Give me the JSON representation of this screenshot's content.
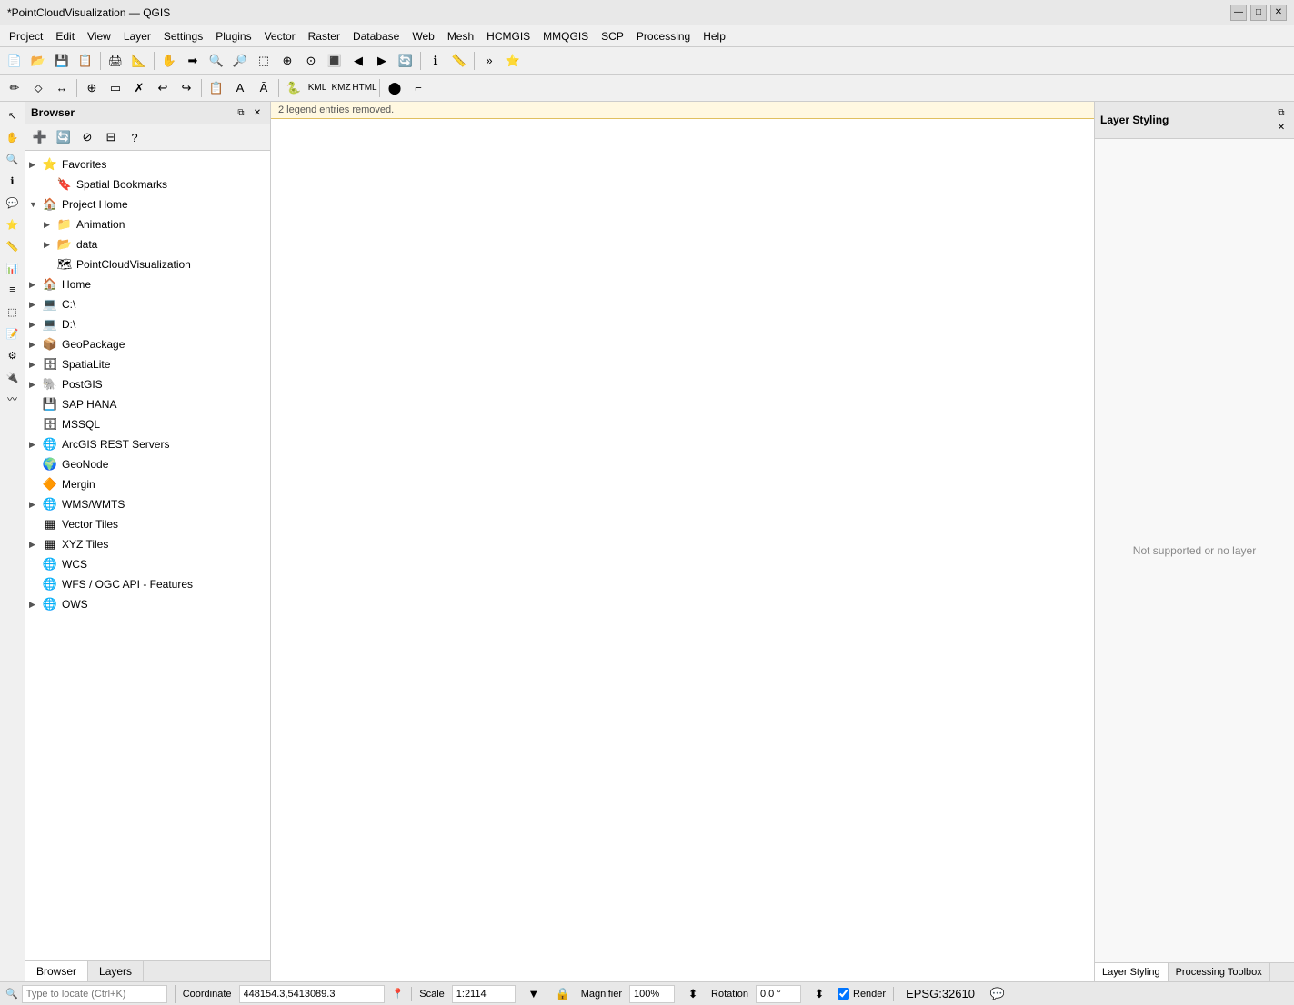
{
  "titleBar": {
    "title": "*PointCloudVisualization — QGIS",
    "minimizeLabel": "—",
    "maximizeLabel": "□",
    "closeLabel": "✕"
  },
  "menuBar": {
    "items": [
      "Project",
      "Edit",
      "View",
      "Layer",
      "Settings",
      "Plugins",
      "Vector",
      "Raster",
      "Database",
      "Web",
      "Mesh",
      "HCMGIS",
      "MMQGIS",
      "SCP",
      "Processing",
      "Help"
    ]
  },
  "browser": {
    "title": "Browser",
    "tree": [
      {
        "id": "favorites",
        "label": "Favorites",
        "indent": 0,
        "arrow": "▶",
        "icon": "⭐"
      },
      {
        "id": "spatial-bookmarks",
        "label": "Spatial Bookmarks",
        "indent": 1,
        "arrow": "",
        "icon": "🔖"
      },
      {
        "id": "project-home",
        "label": "Project Home",
        "indent": 0,
        "arrow": "▼",
        "icon": "🏠"
      },
      {
        "id": "animation",
        "label": "Animation",
        "indent": 1,
        "arrow": "▶",
        "icon": "📁"
      },
      {
        "id": "data",
        "label": "data",
        "indent": 1,
        "arrow": "▶",
        "icon": "📂"
      },
      {
        "id": "pointcloud",
        "label": "PointCloudVisualization",
        "indent": 1,
        "arrow": "",
        "icon": "🗺"
      },
      {
        "id": "home",
        "label": "Home",
        "indent": 0,
        "arrow": "▶",
        "icon": "🏠"
      },
      {
        "id": "c-drive",
        "label": "C:\\",
        "indent": 0,
        "arrow": "▶",
        "icon": "📁"
      },
      {
        "id": "d-drive",
        "label": "D:\\",
        "indent": 0,
        "arrow": "▶",
        "icon": "📁"
      },
      {
        "id": "geopackage",
        "label": "GeoPackage",
        "indent": 0,
        "arrow": "▶",
        "icon": "📦"
      },
      {
        "id": "spatialite",
        "label": "SpatiaLite",
        "indent": 0,
        "arrow": "▶",
        "icon": "🗄"
      },
      {
        "id": "postgis",
        "label": "PostGIS",
        "indent": 0,
        "arrow": "▶",
        "icon": "🐘"
      },
      {
        "id": "sap-hana",
        "label": "SAP HANA",
        "indent": 0,
        "arrow": "",
        "icon": "💾"
      },
      {
        "id": "mssql",
        "label": "MSSQL",
        "indent": 0,
        "arrow": "",
        "icon": "🗄"
      },
      {
        "id": "arcgis-rest",
        "label": "ArcGIS REST Servers",
        "indent": 0,
        "arrow": "▶",
        "icon": "🌐"
      },
      {
        "id": "geonode",
        "label": "GeoNode",
        "indent": 0,
        "arrow": "",
        "icon": "🌍"
      },
      {
        "id": "mergin",
        "label": "Mergin",
        "indent": 0,
        "arrow": "",
        "icon": "🔶"
      },
      {
        "id": "wms-wmts",
        "label": "WMS/WMTS",
        "indent": 0,
        "arrow": "▶",
        "icon": "🌐"
      },
      {
        "id": "vector-tiles",
        "label": "Vector Tiles",
        "indent": 0,
        "arrow": "",
        "icon": "▦"
      },
      {
        "id": "xyz-tiles",
        "label": "XYZ Tiles",
        "indent": 0,
        "arrow": "▶",
        "icon": "▦"
      },
      {
        "id": "wcs",
        "label": "WCS",
        "indent": 0,
        "arrow": "",
        "icon": "🌐"
      },
      {
        "id": "wfs-ogc",
        "label": "WFS / OGC API - Features",
        "indent": 0,
        "arrow": "",
        "icon": "🌐"
      },
      {
        "id": "ows",
        "label": "OWS",
        "indent": 0,
        "arrow": "▶",
        "icon": "🌐"
      }
    ]
  },
  "layerStyling": {
    "title": "Layer Styling",
    "noLayerText": "Not supported or no layer"
  },
  "bottomTabs": {
    "items": [
      {
        "id": "browser-tab",
        "label": "Browser"
      },
      {
        "id": "layers-tab",
        "label": "Layers"
      }
    ],
    "active": "browser-tab"
  },
  "rightBottomTabs": {
    "items": [
      {
        "id": "layer-styling-tab",
        "label": "Layer Styling"
      },
      {
        "id": "processing-toolbox-tab",
        "label": "Processing Toolbox"
      }
    ],
    "active": "layer-styling-tab"
  },
  "statusBar": {
    "locatePlaceholder": "Type to locate (Ctrl+K)",
    "message": "2 legend entries removed.",
    "coordinateLabel": "Coordinate",
    "coordinate": "448154.3,5413089.3",
    "scaleLabel": "Scale",
    "scale": "1:2114",
    "magnifierLabel": "Magnifier",
    "magnifier": "100%",
    "rotationLabel": "Rotation",
    "rotation": "0.0 °",
    "renderLabel": "Render",
    "epsg": "EPSG:32610"
  },
  "icons": {
    "add": "➕",
    "refresh": "🔄",
    "filter": "🔽",
    "settings": "⚙",
    "help": "?",
    "collapse": "⊟",
    "expand": "⊞",
    "close": "✕",
    "search": "🔍",
    "arrow-right": "▶",
    "arrow-down": "▼"
  }
}
